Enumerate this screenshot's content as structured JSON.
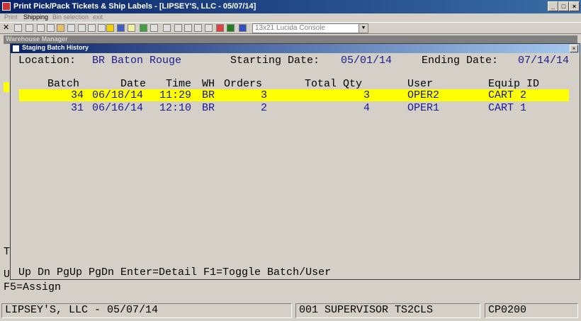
{
  "window": {
    "title": "Print Pick/Pack Tickets & Ship Labels - [LIPSEY'S, LLC - 05/07/14]",
    "minimize": "_",
    "maximize": "□",
    "close": "×"
  },
  "menu": [
    "Print",
    "Shipping",
    "Bin selection",
    "exit"
  ],
  "toolbar": {
    "font_select": "13x21 Lucida Console"
  },
  "background_window": {
    "title": "Warehouse Manager",
    "footer_line": "F5=Assign",
    "fragment_t": "T",
    "fragment_u": "U"
  },
  "dialog": {
    "title": "Staging Batch History",
    "close": "×",
    "location_label": "Location:",
    "location_value": "BR Baton Rouge",
    "start_label": "Starting Date:",
    "start_value": "05/01/14",
    "end_label": "Ending Date:",
    "end_value": "07/14/14",
    "columns": [
      "Batch",
      "Date",
      "Time",
      "WH",
      "Orders",
      "Total Qty",
      "User",
      "Equip ID"
    ],
    "rows": [
      {
        "batch": "34",
        "date": "06/18/14",
        "time": "11:29",
        "wh": "BR",
        "orders": "3",
        "qty": "3",
        "user": "OPER2",
        "equip": "CART 2"
      },
      {
        "batch": "31",
        "date": "06/16/14",
        "time": "12:10",
        "wh": "BR",
        "orders": "2",
        "qty": "4",
        "user": "OPER1",
        "equip": "CART 1"
      }
    ],
    "help_line": "Up Dn PgUp PgDn Enter=Detail F1=Toggle Batch/User"
  },
  "statusbar": {
    "company": "LIPSEY'S, LLC - 05/07/14",
    "user": "001 SUPERVISOR TS2CLS",
    "program": "CP0200"
  },
  "colors": {
    "highlight": "#ffff00",
    "text_accent": "#1a1a90",
    "titlebar": "#0a246a"
  }
}
